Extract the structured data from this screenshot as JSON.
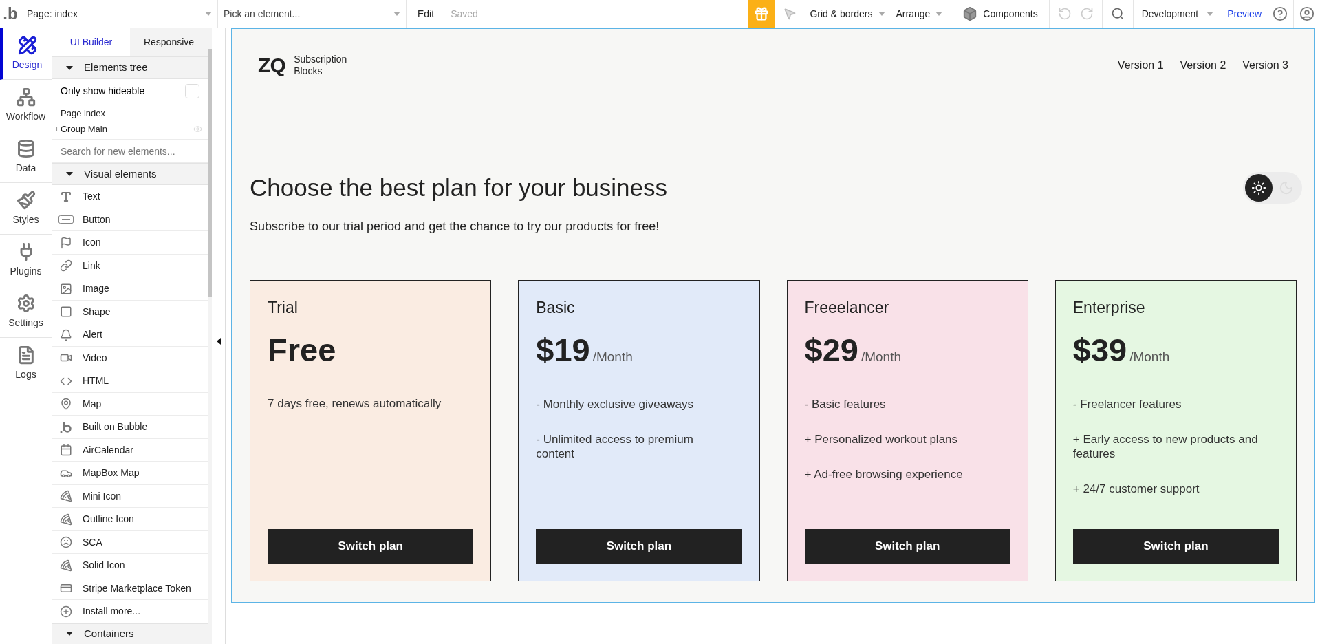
{
  "topbar": {
    "logo": ".b",
    "page_select": "Page: index",
    "element_select": {
      "placeholder": "Pick an element..."
    },
    "edit": "Edit",
    "saved": "Saved",
    "grid": "Grid & borders",
    "arrange": "Arrange",
    "components": "Components",
    "redo_disabled": true,
    "mode": "Development",
    "preview": "Preview"
  },
  "rail": [
    {
      "label": "Design",
      "selected": true
    },
    {
      "label": "Workflow",
      "selected": false
    },
    {
      "label": "Data",
      "selected": false
    },
    {
      "label": "Styles",
      "selected": false
    },
    {
      "label": "Plugins",
      "selected": false
    },
    {
      "label": "Settings",
      "selected": false
    },
    {
      "label": "Logs",
      "selected": false
    }
  ],
  "panel_tabs": [
    {
      "label": "UI Builder",
      "selected": true
    },
    {
      "label": "Responsive",
      "selected": false
    }
  ],
  "elements_tree": {
    "title": "Elements tree",
    "expanded": true,
    "only_hideable": {
      "label": "Only show hideable",
      "checked": false
    },
    "items": [
      {
        "label": "Page index",
        "children": [
          {
            "label": "Group Main"
          }
        ]
      }
    ]
  },
  "search": {
    "placeholder": "Search for new elements..."
  },
  "visual_elements": {
    "title": "Visual elements",
    "expanded": true,
    "items": [
      {
        "label": "Text"
      },
      {
        "label": "Button"
      },
      {
        "label": "Icon"
      },
      {
        "label": "Link"
      },
      {
        "label": "Image"
      },
      {
        "label": "Shape"
      },
      {
        "label": "Alert"
      },
      {
        "label": "Video"
      },
      {
        "label": "HTML"
      },
      {
        "label": "Map"
      },
      {
        "label": "Built on Bubble"
      },
      {
        "label": "AirCalendar"
      },
      {
        "label": "MapBox Map"
      },
      {
        "label": "Mini Icon"
      },
      {
        "label": "Outline Icon"
      },
      {
        "label": "SCA"
      },
      {
        "label": "Solid Icon"
      },
      {
        "label": "Stripe Marketplace Token"
      },
      {
        "label": "Install more..."
      }
    ]
  },
  "containers": {
    "title": "Containers",
    "expanded": true
  },
  "canvas": {
    "logo_mark": "ZQ",
    "logo_text": [
      "Subscription",
      "Blocks"
    ],
    "nav": [
      "Version 1",
      "Version 2",
      "Version 3"
    ],
    "title": "Choose the best plan for your business",
    "subtitle": "Subscribe to our trial period and get the chance to try our products for free!",
    "theme_toggle": [
      {
        "kind": "sun",
        "selected": true
      },
      {
        "kind": "moon",
        "selected": false
      }
    ],
    "plans": [
      {
        "name": "Trial",
        "price": "Free",
        "color": "#faece2",
        "features": [
          "7 days free, renews automatically"
        ],
        "button": "Switch plan"
      },
      {
        "name": "Basic",
        "price": "$19",
        "period": "/Month",
        "color": "#e1eaf9",
        "features": [
          "- Monthly exclusive giveaways",
          "- Unlimited access to premium content"
        ],
        "button": "Switch plan"
      },
      {
        "name": "Freeelancer",
        "price": "$29",
        "period": "/Month",
        "color": "#f9e1e8",
        "features": [
          "- Basic features",
          "+ Personalized workout plans",
          "+ Ad-free browsing experience"
        ],
        "button": "Switch plan"
      },
      {
        "name": "Enterprise",
        "price": "$39",
        "period": "/Month",
        "color": "#e5f7e2",
        "features": [
          "- Freelancer features",
          "+ Early access to new products and features",
          "+ 24/7 customer support"
        ],
        "button": "Switch plan"
      }
    ]
  }
}
